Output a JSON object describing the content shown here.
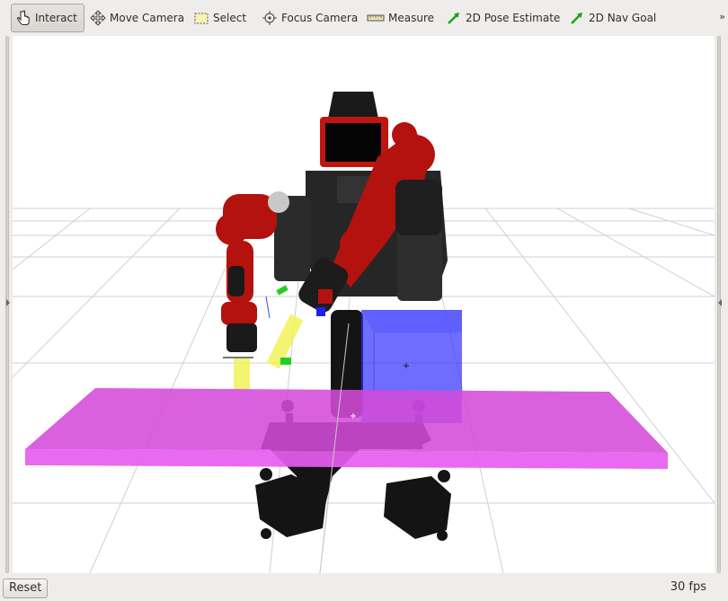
{
  "toolbar": {
    "tools": [
      {
        "label": "Interact",
        "icon": "hand-pointer-icon",
        "active": true
      },
      {
        "label": "Move Camera",
        "icon": "move-camera-icon",
        "active": false
      },
      {
        "label": "Select",
        "icon": "select-box-icon",
        "active": false
      },
      {
        "label": "Focus Camera",
        "icon": "focus-crosshair-icon",
        "active": false
      },
      {
        "label": "Measure",
        "icon": "ruler-icon",
        "active": false
      },
      {
        "label": "2D Pose Estimate",
        "icon": "green-arrow-icon",
        "active": false
      },
      {
        "label": "2D Nav Goal",
        "icon": "green-arrow-icon",
        "active": false
      }
    ],
    "overflow": "»"
  },
  "status": {
    "reset_label": "Reset",
    "fps_text": "30 fps"
  },
  "colors": {
    "planning_scene_table": "#e24fe6",
    "collision_box": "#2b2bff",
    "robot_red": "#b3120f",
    "robot_black": "#1c1c1c",
    "grid": "#cfcfcf",
    "pose_arrow": "#1fb51f"
  }
}
